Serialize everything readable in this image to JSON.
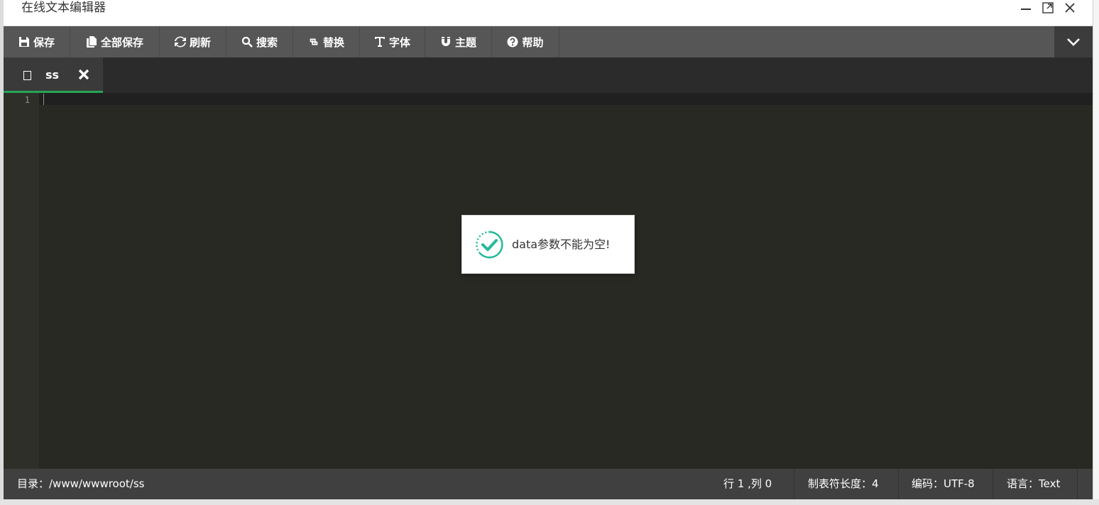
{
  "window": {
    "title": "在线文本编辑器",
    "minimize_label": "—",
    "close_label": "✕"
  },
  "toolbar": {
    "buttons": [
      {
        "label": "保存",
        "icon": "save-icon"
      },
      {
        "label": "全部保存",
        "icon": "copy-icon"
      },
      {
        "label": "刷新",
        "icon": "refresh-icon"
      },
      {
        "label": "搜索",
        "icon": "search-icon"
      },
      {
        "label": "替换",
        "icon": "retweet-icon"
      },
      {
        "label": "字体",
        "icon": "text-height-icon"
      },
      {
        "label": "主题",
        "icon": "magnet-icon"
      },
      {
        "label": "帮助",
        "icon": "question-circle-icon"
      }
    ],
    "collapse_icon": "chevron-down-icon"
  },
  "tabs": [
    {
      "label": "ss",
      "icon": "file-icon",
      "close_icon": "close-icon",
      "active": true
    }
  ],
  "editor": {
    "line_numbers": [
      "1"
    ],
    "content": ""
  },
  "toast": {
    "icon": "check-circle-icon",
    "message": "data参数不能为空!",
    "icon_color": "#26b99a"
  },
  "statusbar": {
    "directory": "目录：/www/wwwroot/ss",
    "position": "行 1 ,列 0",
    "tab_size": "制表符长度：4",
    "encoding": "编码：UTF-8",
    "language": "语言：Text"
  },
  "colors": {
    "accent": "#27a556",
    "toolbar_bg": "#565656",
    "editor_bg": "#282923"
  }
}
